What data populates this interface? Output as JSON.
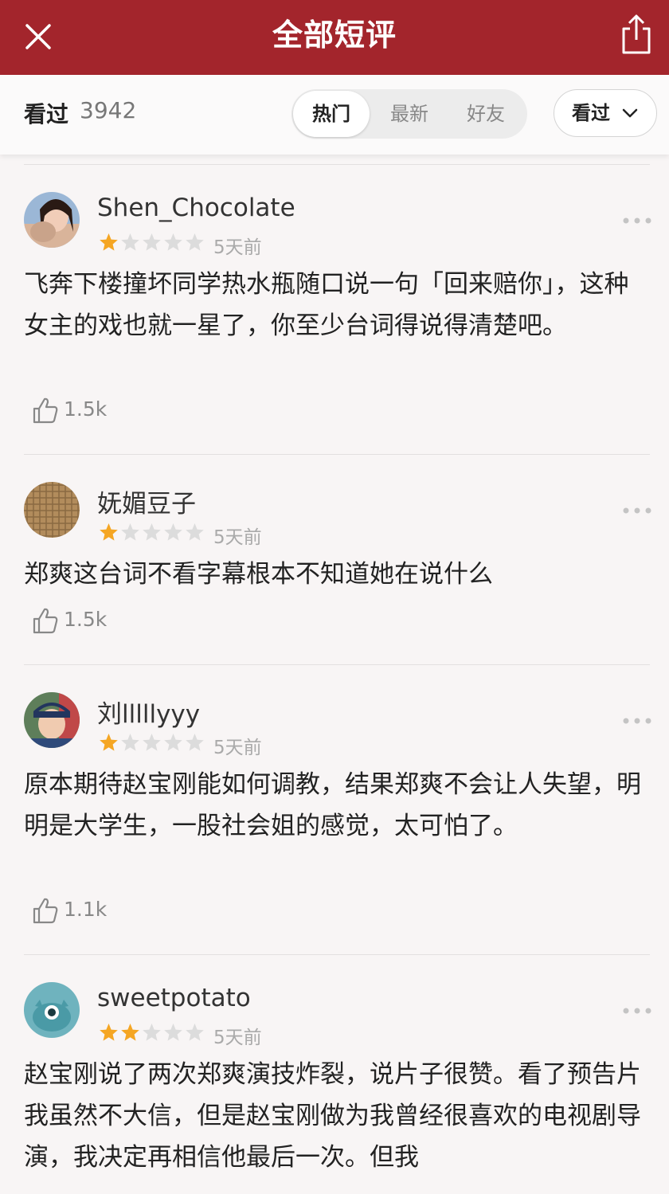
{
  "header": {
    "title": "全部短评",
    "bg_color": "#a3252c"
  },
  "filter": {
    "count_label": "看过",
    "count_value": "3942",
    "tabs": [
      {
        "label": "热门",
        "active": true
      },
      {
        "label": "最新",
        "active": false
      },
      {
        "label": "好友",
        "active": false
      }
    ],
    "status_select": "看过"
  },
  "reviews": [
    {
      "username": "Shen_Chocolate",
      "rating": 1,
      "date": "5天前",
      "text": "飞奔下楼撞坏同学热水瓶随口说一句「回来赔你」，这种女主的戏也就一星了，你至少台词得说得清楚吧。",
      "likes": "1.5k"
    },
    {
      "username": "妩媚豆子",
      "rating": 1,
      "date": "5天前",
      "text": "郑爽这台词不看字幕根本不知道她在说什么",
      "likes": "1.5k"
    },
    {
      "username": "刘lllllyyy",
      "rating": 1,
      "date": "5天前",
      "text": "原本期待赵宝刚能如何调教，结果郑爽不会让人失望，明明是大学生，一股社会姐的感觉，太可怕了。",
      "likes": "1.1k"
    },
    {
      "username": "sweetpotato",
      "rating": 2,
      "date": "5天前",
      "text": "赵宝刚说了两次郑爽演技炸裂，说片子很赞。看了预告片我虽然不大信，但是赵宝刚做为我曾经很喜欢的电视剧导演，我决定再相信他最后一次。但我",
      "likes": ""
    }
  ],
  "colors": {
    "star_on": "#f5a623",
    "star_off": "#dcdcdc"
  }
}
